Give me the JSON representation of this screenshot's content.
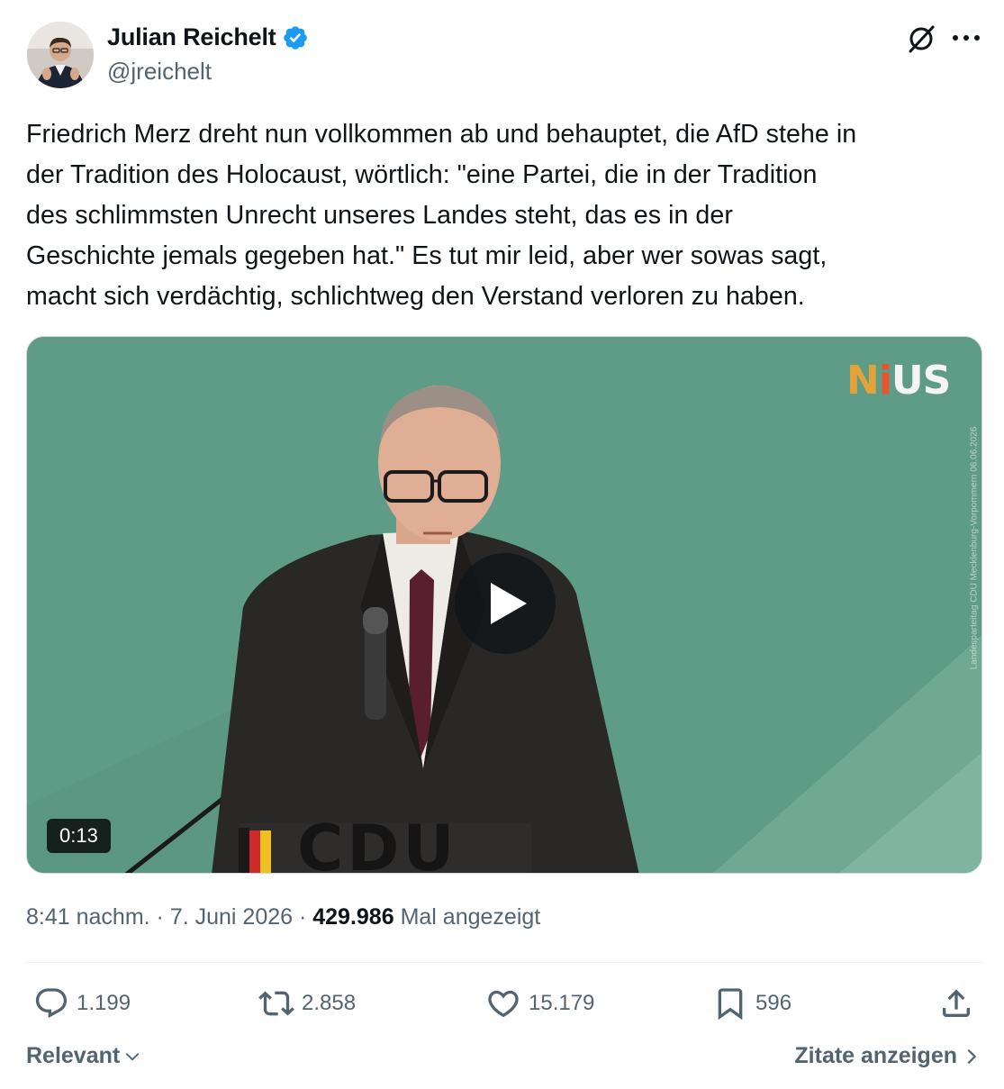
{
  "author": {
    "name": "Julian Reichelt",
    "handle": "@jreichelt",
    "verified": true,
    "avatar_icon": "person-avatar-photo"
  },
  "header_icons": {
    "grok": "grok-icon",
    "more": "more-options-icon"
  },
  "tweet": {
    "text": "Friedrich Merz dreht nun vollkommen ab und behauptet, die AfD stehe in\nder Tradition des Holocaust, wörtlich: \"eine Partei, die in der Tradition\ndes schlimmsten Unrecht unseres Landes steht, das es in der\nGeschichte jemals gegeben hat.\" Es tut mir leid, aber wer sowas sagt,\nmacht sich verdächtig, schlichtweg den Verstand verloren zu haben."
  },
  "video": {
    "duration": "0:13",
    "logo": {
      "n": "N",
      "i": "i",
      "us": "US"
    },
    "watermark": "Landesparteitag CDU Mecklenburg-Vorpommern 06.06.2026",
    "podium_text": "CDU"
  },
  "meta": {
    "time": "8:41 nachm.",
    "sep": " · ",
    "date": "7. Juni 2026",
    "views": "429.986",
    "views_label": "Mal angezeigt"
  },
  "actions": {
    "replies": "1.199",
    "reposts": "2.858",
    "likes": "15.179",
    "bookmarks": "596"
  },
  "footer": {
    "sort_label": "Relevant",
    "quotes_label": "Zitate anzeigen"
  },
  "colors": {
    "text": "#0f1419",
    "secondary": "#536471",
    "verified": "#1d9bf0",
    "video_bg": "#5d9b86"
  }
}
